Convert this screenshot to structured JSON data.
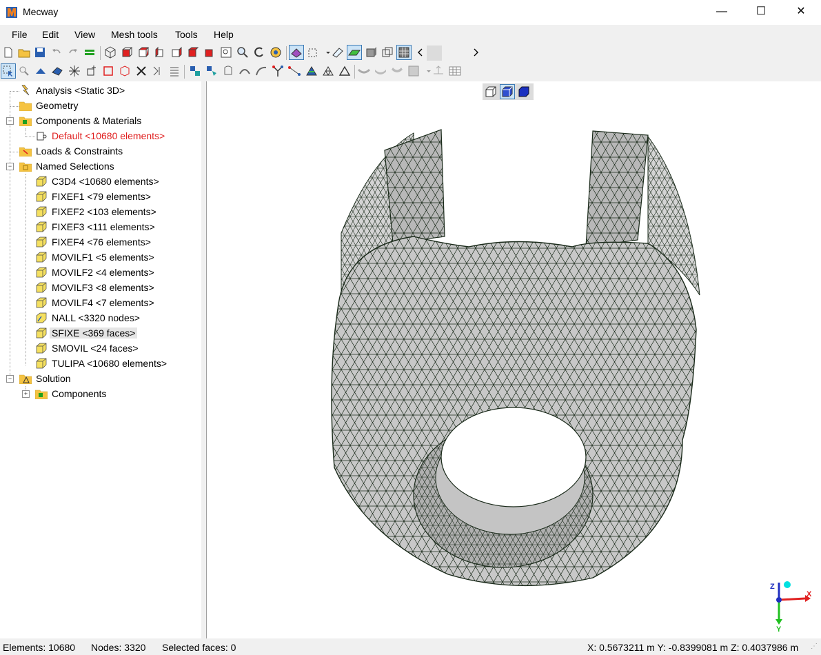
{
  "window": {
    "title": "Mecway",
    "minimize": "—",
    "maximize": "☐",
    "close": "✕"
  },
  "menu": [
    "File",
    "Edit",
    "View",
    "Mesh tools",
    "Tools",
    "Help"
  ],
  "tree": {
    "analysis": "Analysis <Static 3D>",
    "geometry": "Geometry",
    "components": "Components & Materials",
    "default_component": "Default <10680 elements>",
    "loads": "Loads & Constraints",
    "named_selections": "Named Selections",
    "selections": [
      "C3D4 <10680 elements>",
      "FIXEF1 <79 elements>",
      "FIXEF2 <103 elements>",
      "FIXEF3 <111 elements>",
      "FIXEF4 <76 elements>",
      "MOVILF1 <5 elements>",
      "MOVILF2 <4 elements>",
      "MOVILF3 <8 elements>",
      "MOVILF4 <7 elements>",
      "NALL <3320 nodes>",
      "SFIXE <369 faces>",
      "SMOVIL <24 faces>",
      "TULIPA <10680 elements>"
    ],
    "solution": "Solution",
    "solution_components": "Components"
  },
  "axes": {
    "x": "X",
    "y": "Y",
    "z": "Z"
  },
  "status": {
    "elements": "Elements: 10680",
    "nodes": "Nodes: 3320",
    "selected": "Selected faces: 0",
    "coords": "X: 0.5673211 m Y: -0.8399081 m Z: 0.4037986 m"
  },
  "colors": {
    "mesh_fill": "#c8c8c8",
    "mesh_edge": "#1a2a1a",
    "red_text": "#e02020",
    "folder": "#f5c342"
  }
}
